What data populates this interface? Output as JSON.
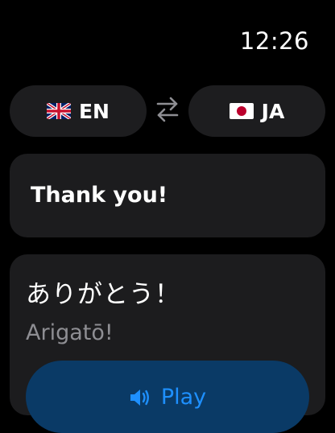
{
  "status": {
    "time": "12:26"
  },
  "languages": {
    "source": {
      "code": "EN",
      "flag_icon": "uk-flag-icon"
    },
    "target": {
      "code": "JA",
      "flag_icon": "japan-flag-icon"
    },
    "swap_icon": "swap-arrows-icon"
  },
  "input": {
    "text": "Thank you!"
  },
  "output": {
    "text": "ありがとう！",
    "romanization": "Arigatō!",
    "play_label": "Play",
    "play_icon": "speaker-icon"
  },
  "colors": {
    "background": "#000000",
    "card": "#1c1c1e",
    "accent": "#1e90ff",
    "secondary_text": "#8e8e93"
  }
}
